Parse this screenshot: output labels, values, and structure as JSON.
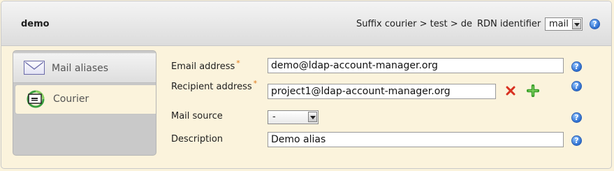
{
  "header": {
    "title": "demo",
    "suffix_text": "Suffix courier > test > de",
    "rdn_label": "RDN identifier",
    "rdn_value": "mail"
  },
  "tabs": [
    {
      "label": "Mail aliases",
      "icon": "envelope-icon",
      "selected": false
    },
    {
      "label": "Courier",
      "icon": "courier-icon",
      "selected": true
    }
  ],
  "form": {
    "email": {
      "label": "Email address",
      "required_mark": "*",
      "value": "demo@ldap-account-manager.org"
    },
    "recipient": {
      "label": "Recipient address",
      "required_mark": "*",
      "value": "project1@ldap-account-manager.org"
    },
    "mail_source": {
      "label": "Mail source",
      "value": "-"
    },
    "description": {
      "label": "Description",
      "value": "Demo alias"
    }
  },
  "colors": {
    "background": "#fbf3dc",
    "help": "#2d6fd0",
    "delete": "#d83020",
    "add": "#3aa02a",
    "required": "#e07a1a"
  }
}
